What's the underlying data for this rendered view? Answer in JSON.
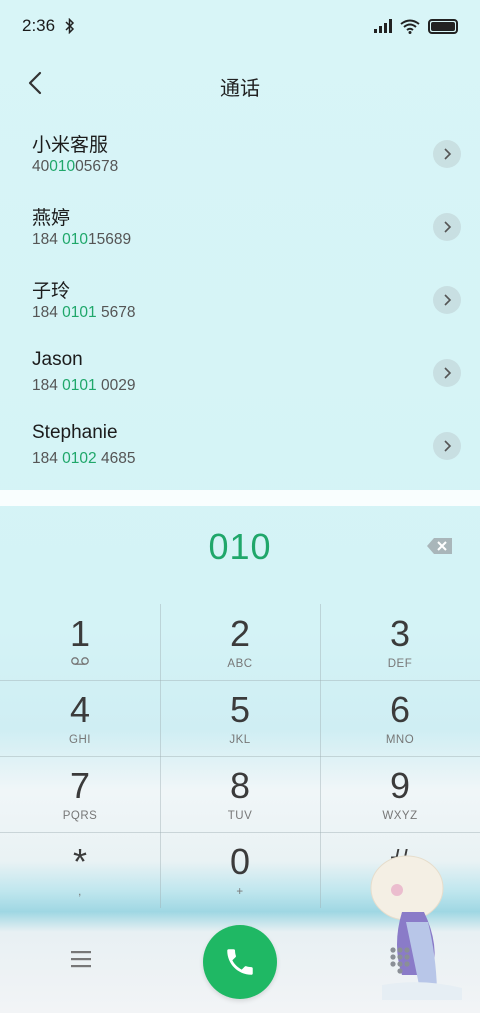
{
  "status_bar": {
    "time": "2:36"
  },
  "header": {
    "title": "通话"
  },
  "contacts": [
    {
      "name": "小米客服",
      "num_pre": "40",
      "num_hl": "010",
      "num_post": "05678"
    },
    {
      "name": "燕婷",
      "num_pre": "184 ",
      "num_hl": "010",
      "num_post": "15689"
    },
    {
      "name": "子玲",
      "num_pre": "184 ",
      "num_hl": "0101",
      "num_post": " 5678"
    },
    {
      "name": "Jason",
      "num_pre": "184 ",
      "num_hl": "0101",
      "num_post": " 0029"
    },
    {
      "name": "Stephanie",
      "num_pre": "184 ",
      "num_hl": "0102",
      "num_post": " 4685"
    }
  ],
  "dialer": {
    "input": "010",
    "keys": [
      {
        "digit": "1",
        "letters": ""
      },
      {
        "digit": "2",
        "letters": "ABC"
      },
      {
        "digit": "3",
        "letters": "DEF"
      },
      {
        "digit": "4",
        "letters": "GHI"
      },
      {
        "digit": "5",
        "letters": "JKL"
      },
      {
        "digit": "6",
        "letters": "MNO"
      },
      {
        "digit": "7",
        "letters": "PQRS"
      },
      {
        "digit": "8",
        "letters": "TUV"
      },
      {
        "digit": "9",
        "letters": "WXYZ"
      },
      {
        "digit": "*",
        "letters": ","
      },
      {
        "digit": "0",
        "letters": "+"
      },
      {
        "digit": "#",
        "letters": ""
      }
    ]
  },
  "colors": {
    "accent": "#1fa76a",
    "call": "#1fb864"
  },
  "icons": [
    "back-icon",
    "voicemail-icon",
    "backspace-icon",
    "menu-icon",
    "phone-icon",
    "dialpad-icon",
    "chevron-right-icon"
  ]
}
